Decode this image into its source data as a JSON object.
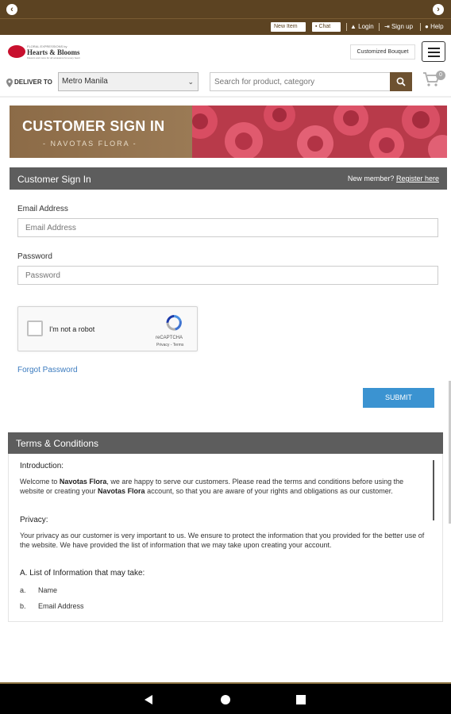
{
  "topbar": {
    "prev_icon": "chevron-left-icon",
    "next_icon": "chevron-right-icon",
    "prev_glyph": "‹",
    "next_glyph": "›"
  },
  "toolbar": {
    "new_item_label": "New Item",
    "chat_label": "Chat",
    "login_label": "Login",
    "signup_label": "Sign up",
    "help_label": "Help"
  },
  "header": {
    "logo_tagline": "FLORAL EXPRESSIONS by",
    "logo_name": "Hearts & Blooms",
    "logo_small": "Flowers and more for all occasions for every heart",
    "customized_label": "Customized Bouquet"
  },
  "deliver": {
    "label": "DELIVER TO",
    "location": "Metro Manila",
    "search_placeholder": "Search for product, category",
    "cart_count": "0"
  },
  "banner": {
    "title": "CUSTOMER SIGN IN",
    "subtitle": "- NAVOTAS FLORA -"
  },
  "signin": {
    "heading": "Customer Sign In",
    "new_member_text": "New member?",
    "register_label": "Register here",
    "email_label": "Email Address",
    "email_placeholder": "Email Address",
    "password_label": "Password",
    "password_placeholder": "Password",
    "captcha_text": "I'm not a robot",
    "captcha_brand": "reCAPTCHA",
    "captcha_links": "Privacy - Terms",
    "forgot_label": "Forgot Password",
    "submit_label": "SUBMIT"
  },
  "terms": {
    "heading": "Terms & Conditions",
    "intro_title": "Introduction:",
    "intro_p1": "Welcome to ",
    "brand": "Navotas Flora",
    "intro_p2": ", we are happy to serve our customers. Please read the terms and conditions before using the website or creating your ",
    "intro_p3": " account, so that you are aware of your rights and obligations as our customer.",
    "privacy_title": "Privacy:",
    "privacy_text": "Your privacy as our customer is very important to us. We ensure to protect the information that you provided for the better use of the website. We have provided the list of information that we may take upon creating your account.",
    "list_title": "A. List of Information that may take:",
    "items": [
      {
        "marker": "a.",
        "text": "Name"
      },
      {
        "marker": "b.",
        "text": "Email Address"
      }
    ]
  },
  "colors": {
    "brand_brown": "#5c4322",
    "header_gray": "#5d5d5d",
    "submit_blue": "#3b93d1",
    "link_blue": "#3b7bbf"
  }
}
